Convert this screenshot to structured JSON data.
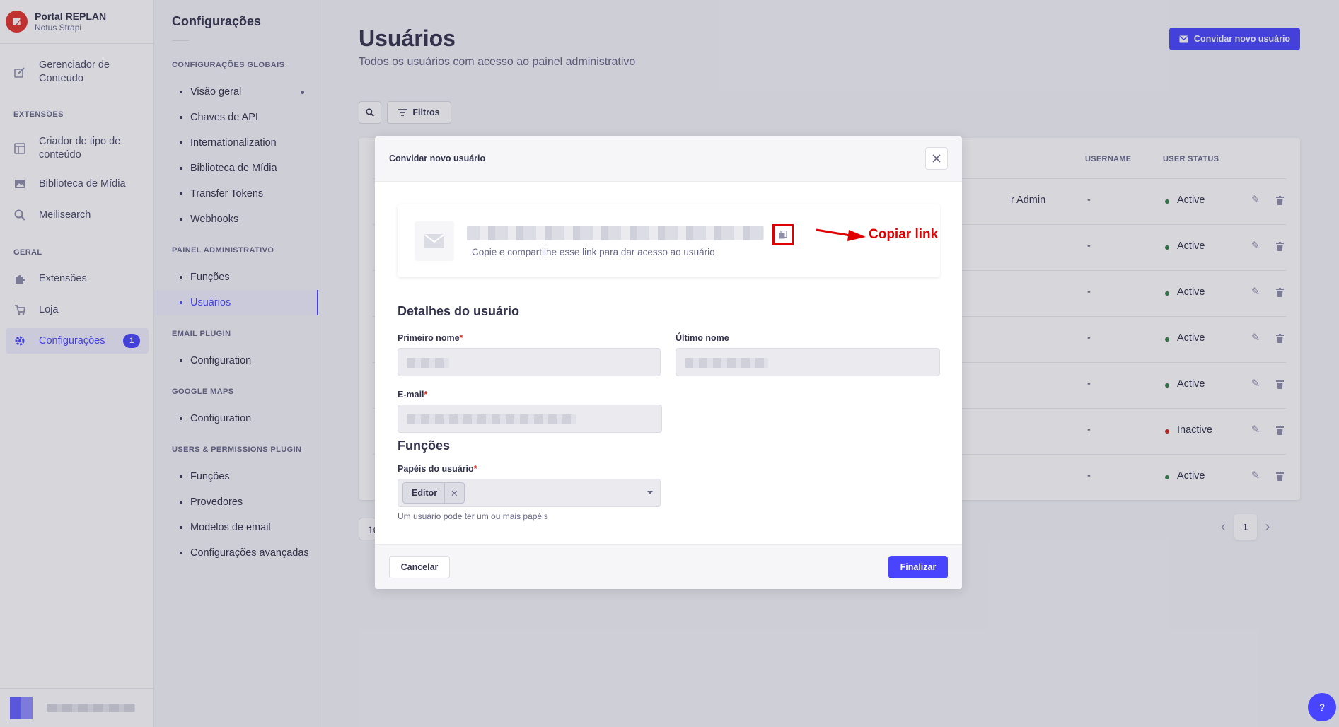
{
  "brand": {
    "title": "Portal REPLAN",
    "subtitle": "Notus Strapi"
  },
  "mainnav": {
    "content_manager": "Gerenciador de Conteúdo",
    "extensions_section": "EXTENSÕES",
    "type_builder": "Criador de tipo de conteúdo",
    "media_library": "Biblioteca de Mídia",
    "meilisearch": "Meilisearch",
    "general_section": "GERAL",
    "plugins": "Extensões",
    "marketplace": "Loja",
    "settings": "Configurações",
    "settings_badge": "1"
  },
  "subnav": {
    "title": "Configurações",
    "global_section": "CONFIGURAÇÕES GLOBAIS",
    "global_items": [
      "Visão geral",
      "Chaves de API",
      "Internationalization",
      "Biblioteca de Mídia",
      "Transfer Tokens",
      "Webhooks"
    ],
    "admin_section": "PAINEL ADMINISTRATIVO",
    "admin_items": [
      "Funções",
      "Usuários"
    ],
    "email_section": "EMAIL PLUGIN",
    "email_items": [
      "Configuration"
    ],
    "maps_section": "GOOGLE MAPS",
    "maps_items": [
      "Configuration"
    ],
    "up_section": "USERS & PERMISSIONS PLUGIN",
    "up_items": [
      "Funções",
      "Provedores",
      "Modelos de email",
      "Configurações avançadas"
    ]
  },
  "page": {
    "title": "Usuários",
    "subtitle": "Todos os usuários com acesso ao painel administrativo",
    "invite_button": "Convidar novo usuário",
    "filters_button": "Filtros"
  },
  "table": {
    "headers": {
      "username": "USERNAME",
      "status": "USER STATUS"
    },
    "first_row_role": "r Admin",
    "rows": [
      {
        "username": "-",
        "status": "Active"
      },
      {
        "username": "-",
        "status": "Active"
      },
      {
        "username": "-",
        "status": "Active"
      },
      {
        "username": "-",
        "status": "Active"
      },
      {
        "username": "-",
        "status": "Active"
      },
      {
        "username": "-",
        "status": "Inactive"
      },
      {
        "username": "-",
        "status": "Active"
      }
    ],
    "page_size": "10",
    "current_page": "1"
  },
  "modal": {
    "title": "Convidar novo usuário",
    "link_hint": "Copie e compartilhe esse link para dar acesso ao usuário",
    "annotation": "Copiar link",
    "details_title": "Detalhes do usuário",
    "first_name_label": "Primeiro nome",
    "last_name_label": "Último nome",
    "email_label": "E-mail",
    "roles_title": "Funções",
    "roles_label": "Papéis do usuário",
    "role_tag": "Editor",
    "roles_hint": "Um usuário pode ter um ou mais papéis",
    "cancel": "Cancelar",
    "finish": "Finalizar",
    "required_mark": "*"
  },
  "colors": {
    "primary": "#4945ff",
    "active": "#328048",
    "inactive": "#d02b20",
    "annotation": "#e00000"
  },
  "help": "?"
}
